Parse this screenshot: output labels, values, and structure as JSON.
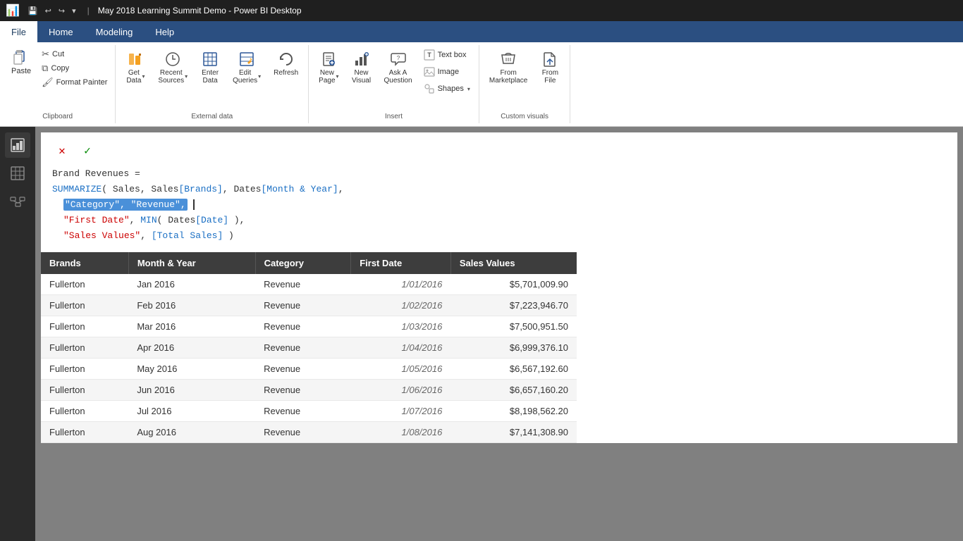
{
  "titleBar": {
    "appName": "May 2018 Learning Summit Demo - Power BI Desktop",
    "windowIcon": "📊",
    "quickAccess": [
      "💾",
      "↩",
      "↪",
      "▾"
    ]
  },
  "menuBar": {
    "items": [
      {
        "id": "file",
        "label": "File",
        "active": true
      },
      {
        "id": "home",
        "label": "Home",
        "active": false
      },
      {
        "id": "modeling",
        "label": "Modeling",
        "active": false
      },
      {
        "id": "help",
        "label": "Help",
        "active": false
      }
    ]
  },
  "ribbon": {
    "groups": [
      {
        "id": "clipboard",
        "label": "Clipboard",
        "buttons": [
          {
            "id": "paste",
            "label": "Paste",
            "type": "large"
          },
          {
            "id": "cut",
            "label": "Cut"
          },
          {
            "id": "copy",
            "label": "Copy"
          },
          {
            "id": "format-painter",
            "label": "Format Painter"
          }
        ]
      },
      {
        "id": "external-data",
        "label": "External data",
        "buttons": [
          {
            "id": "get-data",
            "label": "Get\nData",
            "hasDropdown": true
          },
          {
            "id": "recent-sources",
            "label": "Recent\nSources",
            "hasDropdown": true
          },
          {
            "id": "enter-data",
            "label": "Enter\nData"
          },
          {
            "id": "edit-queries",
            "label": "Edit\nQueries",
            "hasDropdown": true
          },
          {
            "id": "refresh",
            "label": "Refresh"
          }
        ]
      },
      {
        "id": "insert",
        "label": "Insert",
        "buttons": [
          {
            "id": "new-page",
            "label": "New\nPage",
            "hasDropdown": true
          },
          {
            "id": "new-visual",
            "label": "New\nVisual"
          },
          {
            "id": "ask-question",
            "label": "Ask A\nQuestion"
          },
          {
            "id": "text-box",
            "label": "Text box"
          },
          {
            "id": "image",
            "label": "Image"
          },
          {
            "id": "shapes",
            "label": "Shapes",
            "hasDropdown": true
          }
        ]
      },
      {
        "id": "custom-visuals",
        "label": "Custom visuals",
        "buttons": [
          {
            "id": "from-marketplace",
            "label": "From\nMarketplace"
          },
          {
            "id": "from-file",
            "label": "From\nFile"
          }
        ]
      }
    ]
  },
  "formulaBar": {
    "cancelLabel": "✕",
    "confirmLabel": "✓",
    "line1": "Brand Revenues =",
    "line2_pre": "SUMMARIZE( Sales, Sales[Brands], Dates[Month & Year],",
    "line3_sel": "\"Category\", \"Revenue\",",
    "line4": "    \"First Date\", MIN( Dates[Date] ),",
    "line5": "    \"Sales Values\", [Total Sales] )"
  },
  "table": {
    "headers": [
      "Brands",
      "Month & Year",
      "Category",
      "First Date",
      "Sales Values"
    ],
    "rows": [
      {
        "brands": "Fullerton",
        "month": "Jan 2016",
        "category": "Revenue",
        "firstDate": "1/01/2016",
        "salesValues": "$5,701,009.90"
      },
      {
        "brands": "Fullerton",
        "month": "Feb 2016",
        "category": "Revenue",
        "firstDate": "1/02/2016",
        "salesValues": "$7,223,946.70"
      },
      {
        "brands": "Fullerton",
        "month": "Mar 2016",
        "category": "Revenue",
        "firstDate": "1/03/2016",
        "salesValues": "$7,500,951.50"
      },
      {
        "brands": "Fullerton",
        "month": "Apr 2016",
        "category": "Revenue",
        "firstDate": "1/04/2016",
        "salesValues": "$6,999,376.10"
      },
      {
        "brands": "Fullerton",
        "month": "May 2016",
        "category": "Revenue",
        "firstDate": "1/05/2016",
        "salesValues": "$6,567,192.60"
      },
      {
        "brands": "Fullerton",
        "month": "Jun 2016",
        "category": "Revenue",
        "firstDate": "1/06/2016",
        "salesValues": "$6,657,160.20"
      },
      {
        "brands": "Fullerton",
        "month": "Jul 2016",
        "category": "Revenue",
        "firstDate": "1/07/2016",
        "salesValues": "$8,198,562.20"
      },
      {
        "brands": "Fullerton",
        "month": "Aug 2016",
        "category": "Revenue",
        "firstDate": "1/08/2016",
        "salesValues": "$7,141,308.90"
      }
    ]
  },
  "sidebar": {
    "items": [
      {
        "id": "report",
        "icon": "📊"
      },
      {
        "id": "data",
        "icon": "⊞"
      },
      {
        "id": "model",
        "icon": "⬡"
      }
    ]
  }
}
